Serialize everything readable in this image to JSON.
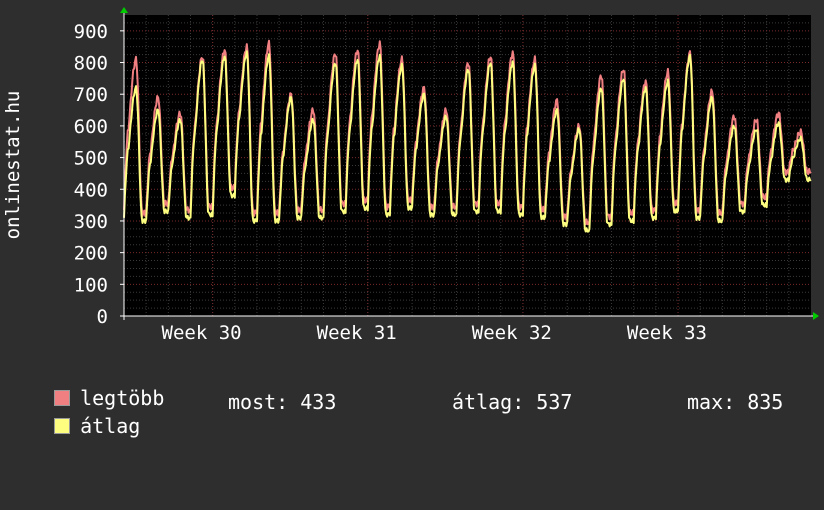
{
  "colors": {
    "background": "#2e2e2e",
    "plot_background": "#000000",
    "grid_minor": "#3a3a3a",
    "grid_major": "#7a2a2a",
    "max_series": "#f07f82",
    "avg_series": "#fdfd80",
    "text": "#ffffff",
    "axis_arrow": "#00cc00"
  },
  "chart_data": {
    "type": "line",
    "ylabel": "onlinestat.hu",
    "ylim": [
      0,
      950
    ],
    "yticks": [
      0,
      100,
      200,
      300,
      400,
      500,
      600,
      700,
      800,
      900
    ],
    "x_domain": [
      0,
      31
    ],
    "week_labels": [
      {
        "label": "Week 30",
        "x": 9
      },
      {
        "label": "Week 31",
        "x": 16
      },
      {
        "label": "Week 32",
        "x": 23
      },
      {
        "label": "Week 33",
        "x": 30
      }
    ],
    "grid": true,
    "legend_placement": "bottom-left",
    "daily_peaks_avg": [
      720,
      650,
      620,
      810,
      820,
      830,
      820,
      690,
      620,
      800,
      810,
      820,
      790,
      700,
      630,
      780,
      800,
      800,
      790,
      650,
      590,
      720,
      750,
      720,
      740,
      820,
      690,
      600,
      590,
      610,
      560
    ],
    "daily_troughs_avg": [
      310,
      300,
      330,
      310,
      320,
      380,
      300,
      300,
      310,
      310,
      330,
      340,
      320,
      340,
      320,
      320,
      330,
      330,
      320,
      310,
      290,
      270,
      290,
      300,
      310,
      330,
      310,
      300,
      330,
      350,
      430
    ],
    "series": [
      {
        "name": "legtöbb",
        "color": "#f07f82",
        "values": [
          810,
          690,
          640,
          820,
          840,
          850,
          860,
          700,
          650,
          830,
          840,
          860,
          810,
          720,
          650,
          800,
          820,
          830,
          810,
          680,
          600,
          760,
          780,
          740,
          770,
          830,
          710,
          630,
          620,
          640,
          580
        ]
      },
      {
        "name": "átlag",
        "color": "#fdfd80",
        "values": [
          720,
          650,
          620,
          810,
          820,
          830,
          820,
          690,
          620,
          800,
          810,
          820,
          790,
          700,
          630,
          780,
          800,
          800,
          790,
          650,
          590,
          720,
          750,
          720,
          740,
          820,
          690,
          600,
          590,
          610,
          560
        ]
      }
    ]
  },
  "legend": {
    "max_label": "legtöbb",
    "avg_label": "átlag",
    "now": "most: 433",
    "average": "átlag: 537",
    "maximum": "max: 835"
  }
}
